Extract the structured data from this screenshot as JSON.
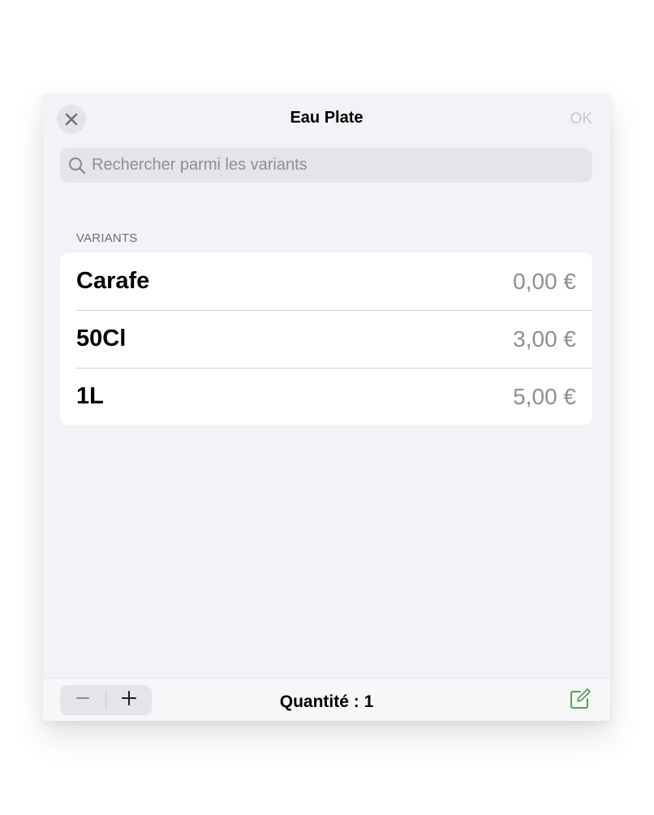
{
  "header": {
    "title": "Eau Plate",
    "ok_label": "OK"
  },
  "search": {
    "placeholder": "Rechercher parmi les variants",
    "value": ""
  },
  "variants": {
    "section_label": "VARIANTS",
    "items": [
      {
        "name": "Carafe",
        "price": "0,00 €"
      },
      {
        "name": "50Cl",
        "price": "3,00 €"
      },
      {
        "name": "1L",
        "price": "5,00 €"
      }
    ]
  },
  "footer": {
    "quantity_label": "Quantité : 1"
  },
  "icons": {
    "close": "close-icon",
    "search": "search-icon",
    "minus": "minus-icon",
    "plus": "plus-icon",
    "note": "compose-note-icon"
  },
  "colors": {
    "sheet_background": "#f2f2f7",
    "accent_green": "#5aa05a",
    "disabled_text": "#c7c7cc",
    "secondary_text": "#8e8e93"
  }
}
